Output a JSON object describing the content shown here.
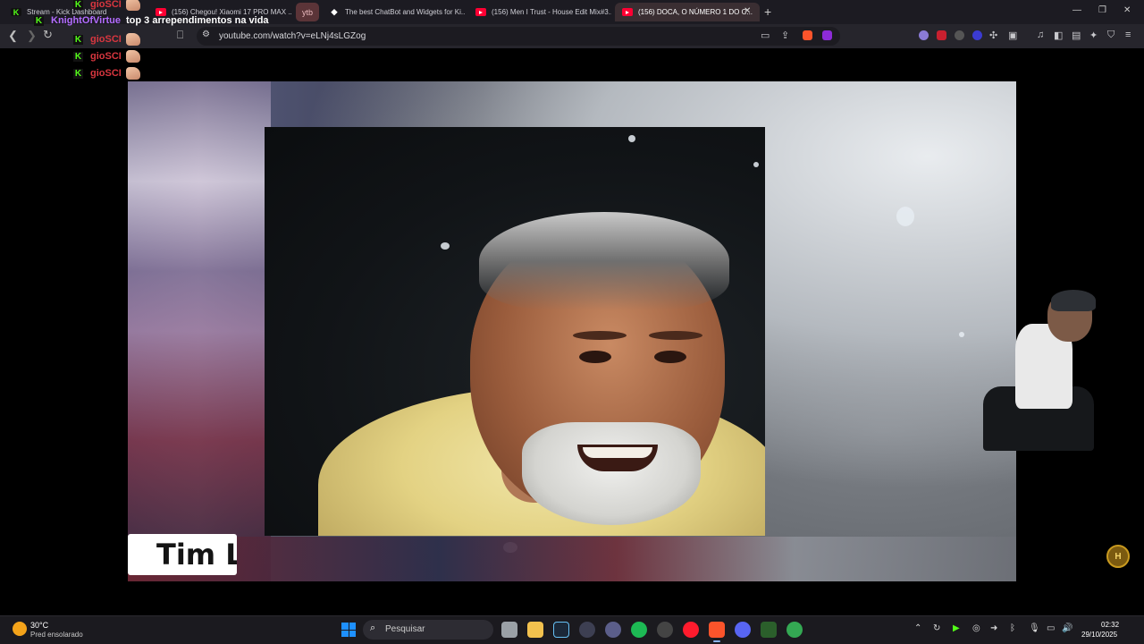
{
  "tabs": [
    {
      "title": "Stream - Kick Dashboard",
      "icon": "kick-icon"
    },
    {
      "title": "(156) Chegou! Xiaomi 17 PRO MAX ...",
      "icon": "youtube-icon"
    },
    {
      "title": "ytb",
      "icon": "none"
    },
    {
      "title": "The best ChatBot and Widgets for Ki...",
      "icon": "kick-widget-icon"
    },
    {
      "title": "(156) Men I Trust - House Edit Mix#3...",
      "icon": "youtube-icon"
    },
    {
      "title": "(156) DOCA, O NÚMERO 1 DO C...",
      "icon": "youtube-icon"
    }
  ],
  "address_bar": {
    "url": "youtube.com/watch?v=eLNj4sLGZog"
  },
  "chat": [
    {
      "user": "gioSCI",
      "message": ""
    },
    {
      "user": "KnightOfVirtue",
      "message": "top 3 arrependimentos na vida"
    },
    {
      "user": "gioSCI",
      "message": ""
    },
    {
      "user": "gioSCI",
      "message": ""
    },
    {
      "user": "gioSCI",
      "message": ""
    }
  ],
  "video": {
    "lower_third_text": "Tim L"
  },
  "taskbar": {
    "weather_temp": "30°C",
    "weather_desc": "Pred ensolarado",
    "search_placeholder": "Pesquisar",
    "time": "02:32",
    "date": "29/10/2025"
  },
  "colors": {
    "tab_bg": "#1c1b22",
    "toolbar_bg": "#26252c",
    "kick_green": "#53fc18",
    "chat_user_red": "#d8363f",
    "chat_user_purple": "#b36cff",
    "youtube_red": "#ff0033",
    "taskbar_bg": "#1b1a1f"
  }
}
